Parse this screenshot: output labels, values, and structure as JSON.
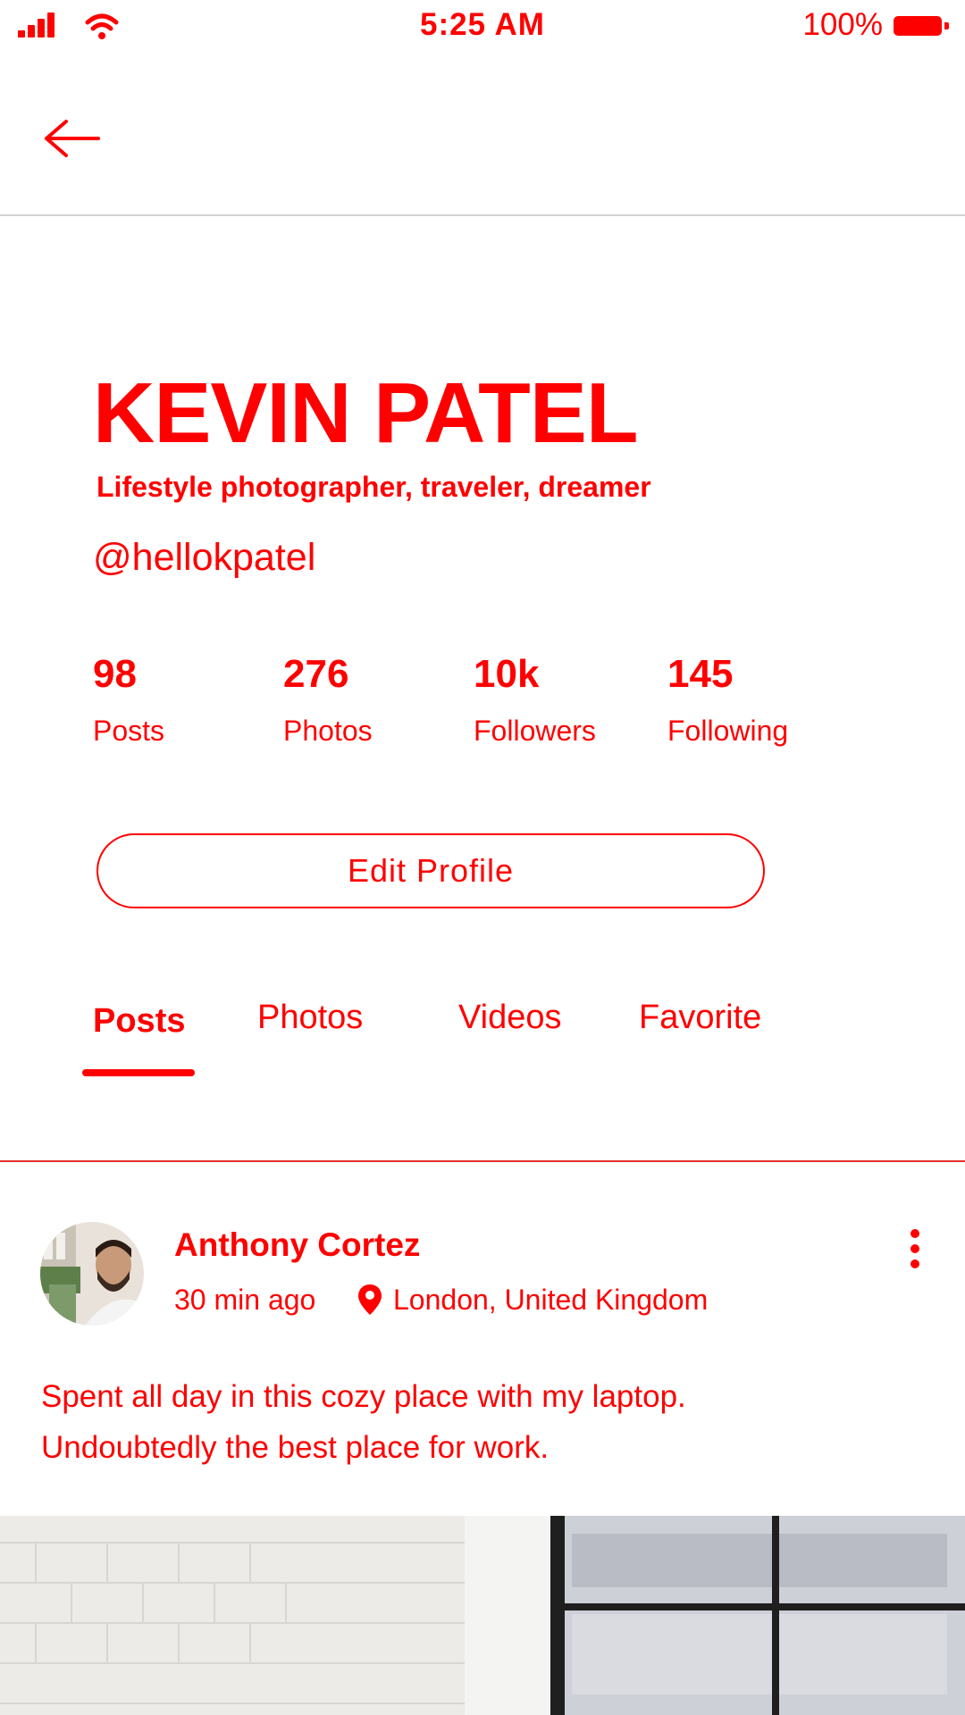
{
  "status_bar": {
    "time": "5:25 AM",
    "battery": "100%"
  },
  "profile": {
    "name": "KEVIN PATEL",
    "bio": "Lifestyle photographer, traveler, dreamer",
    "handle": "@hellokpatel",
    "stats": [
      {
        "value": "98",
        "label": "Posts"
      },
      {
        "value": "276",
        "label": "Photos"
      },
      {
        "value": "10k",
        "label": "Followers"
      },
      {
        "value": "145",
        "label": "Following"
      }
    ],
    "edit_button": "Edit Profile"
  },
  "tabs": [
    {
      "label": "Posts",
      "active": true
    },
    {
      "label": "Photos",
      "active": false
    },
    {
      "label": "Videos",
      "active": false
    },
    {
      "label": "Favorite",
      "active": false
    }
  ],
  "post": {
    "author": "Anthony Cortez",
    "time": "30 min ago",
    "location": "London, United Kingdom",
    "text_line1": "Spent all day in this cozy place with my laptop.",
    "text_line2": "Undoubtedly the best place for work."
  },
  "colors": {
    "accent": "#ff0000",
    "background": "#ffffff",
    "divider": "#d2d2d2"
  },
  "icons": [
    "signal-icon",
    "wifi-icon",
    "battery-icon",
    "back-arrow-icon",
    "location-pin-icon",
    "more-vertical-icon"
  ]
}
